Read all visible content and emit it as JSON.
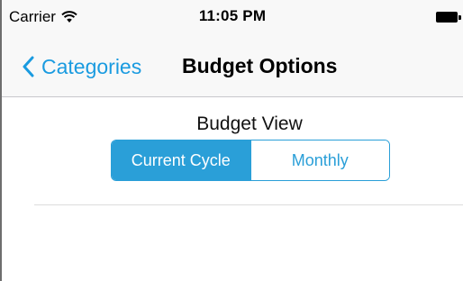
{
  "status_bar": {
    "carrier": "Carrier",
    "time": "11:05 PM",
    "wifi_icon": "wifi-icon",
    "battery_icon": "battery-icon"
  },
  "nav_bar": {
    "back_label": "Categories",
    "back_icon": "chevron-left-icon",
    "title": "Budget Options"
  },
  "budget_view": {
    "label": "Budget View",
    "segments": [
      {
        "label": "Current Cycle",
        "selected": true
      },
      {
        "label": "Monthly",
        "selected": false
      }
    ]
  },
  "colors": {
    "accent": "#2a9fd8",
    "link": "#1a9be0",
    "bar_background": "#f8f8f8"
  }
}
